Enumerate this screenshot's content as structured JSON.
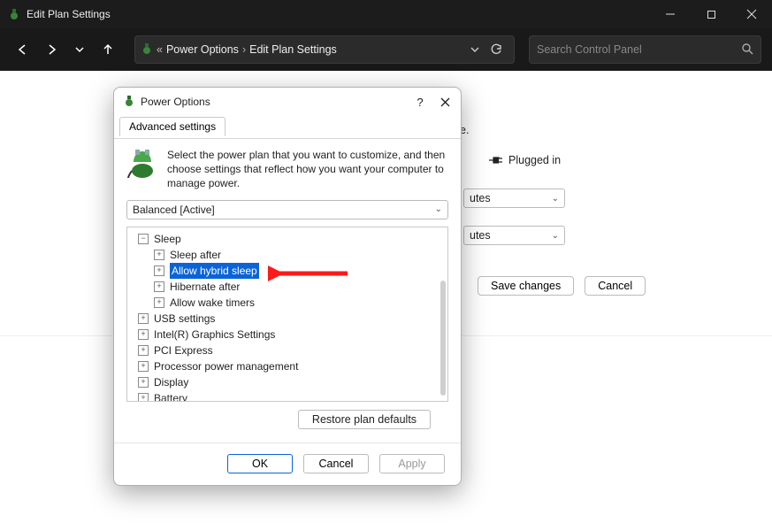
{
  "window": {
    "title": "Edit Plan Settings"
  },
  "nav": {
    "crumb1": "Power Options",
    "crumb2": "Edit Plan Settings",
    "search_placeholder": "Search Control Panel"
  },
  "background": {
    "line_end": "e.",
    "plugged_label": "Plugged in",
    "dd1": "utes",
    "dd2": "utes",
    "save": "Save changes",
    "cancel": "Cancel"
  },
  "dialog": {
    "title": "Power Options",
    "help": "?",
    "tab": "Advanced settings",
    "intro": "Select the power plan that you want to customize, and then choose settings that reflect how you want your computer to manage power.",
    "plan": "Balanced [Active]",
    "restore": "Restore plan defaults",
    "ok": "OK",
    "cancel": "Cancel",
    "apply": "Apply"
  },
  "tree": {
    "n0": "Sleep",
    "n1": "Sleep after",
    "n2": "Allow hybrid sleep",
    "n3": "Hibernate after",
    "n4": "Allow wake timers",
    "n5": "USB settings",
    "n6": "Intel(R) Graphics Settings",
    "n7": "PCI Express",
    "n8": "Processor power management",
    "n9": "Display",
    "n10": "Battery"
  }
}
